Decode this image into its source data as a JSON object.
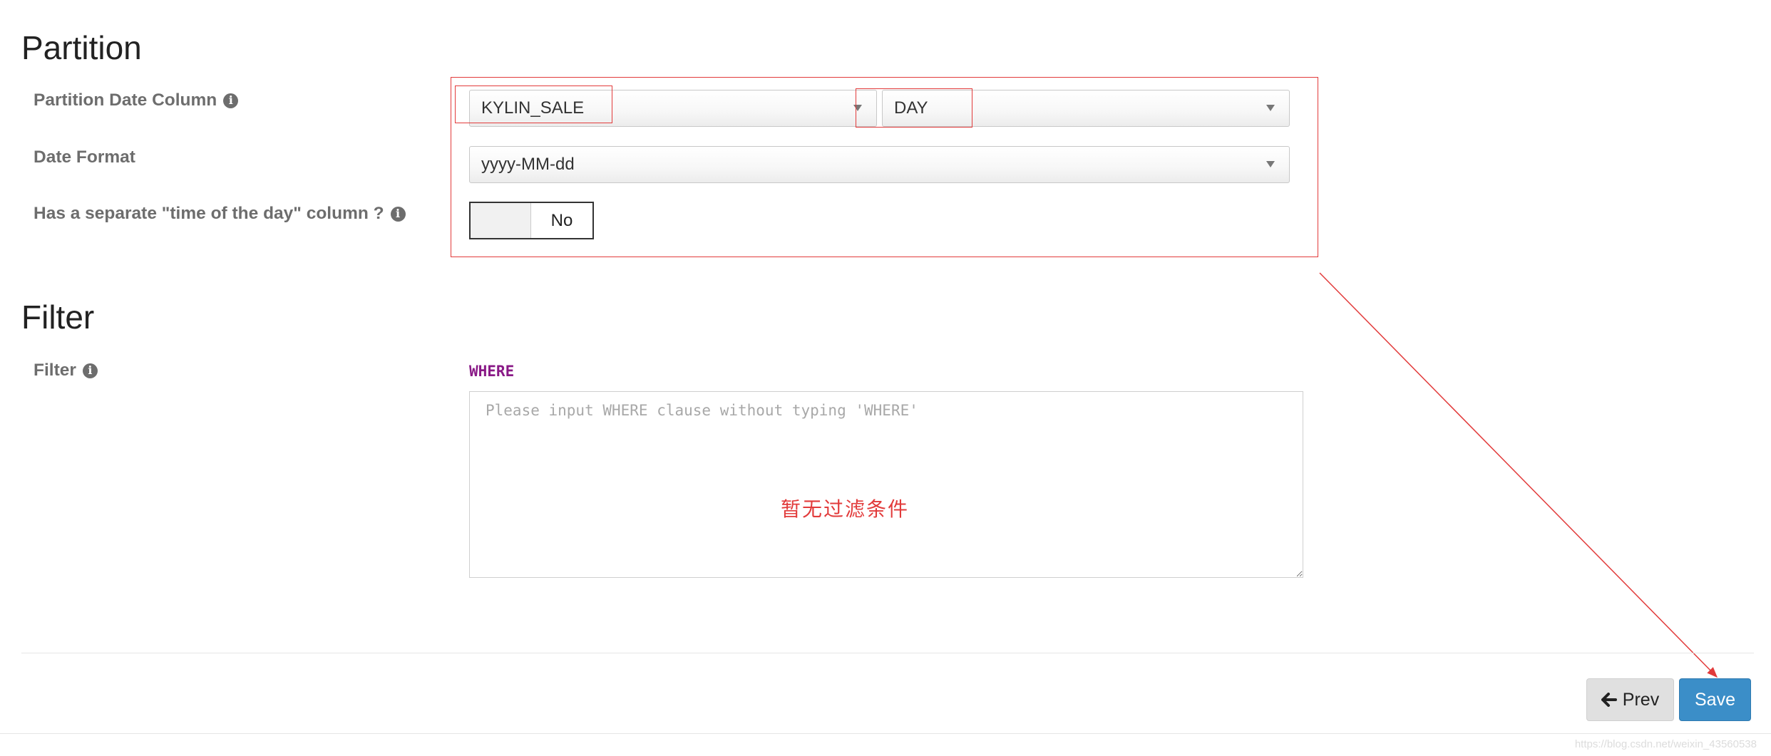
{
  "partition": {
    "title": "Partition",
    "date_column": {
      "label": "Partition Date Column",
      "table_value": "KYLIN_SALE",
      "column_value": "DAY"
    },
    "date_format": {
      "label": "Date Format",
      "value": "yyyy-MM-dd"
    },
    "time_of_day": {
      "label": "Has a separate \"time of the day\" column ?",
      "toggle_state": "No"
    }
  },
  "filter": {
    "title": "Filter",
    "label": "Filter",
    "where_keyword": "WHERE",
    "placeholder": "Please input WHERE clause without typing 'WHERE'",
    "annotation": "暂无过滤条件"
  },
  "footer": {
    "prev_label": "Prev",
    "save_label": "Save"
  },
  "watermark": "https://blog.csdn.net/weixin_43560538",
  "colors": {
    "annotation_red": "#e23b3b",
    "save_blue": "#3b8ec8",
    "where_purple": "#8a1a87"
  },
  "icons": [
    "info-icon",
    "arrow-left-icon",
    "caret-down-icon"
  ]
}
